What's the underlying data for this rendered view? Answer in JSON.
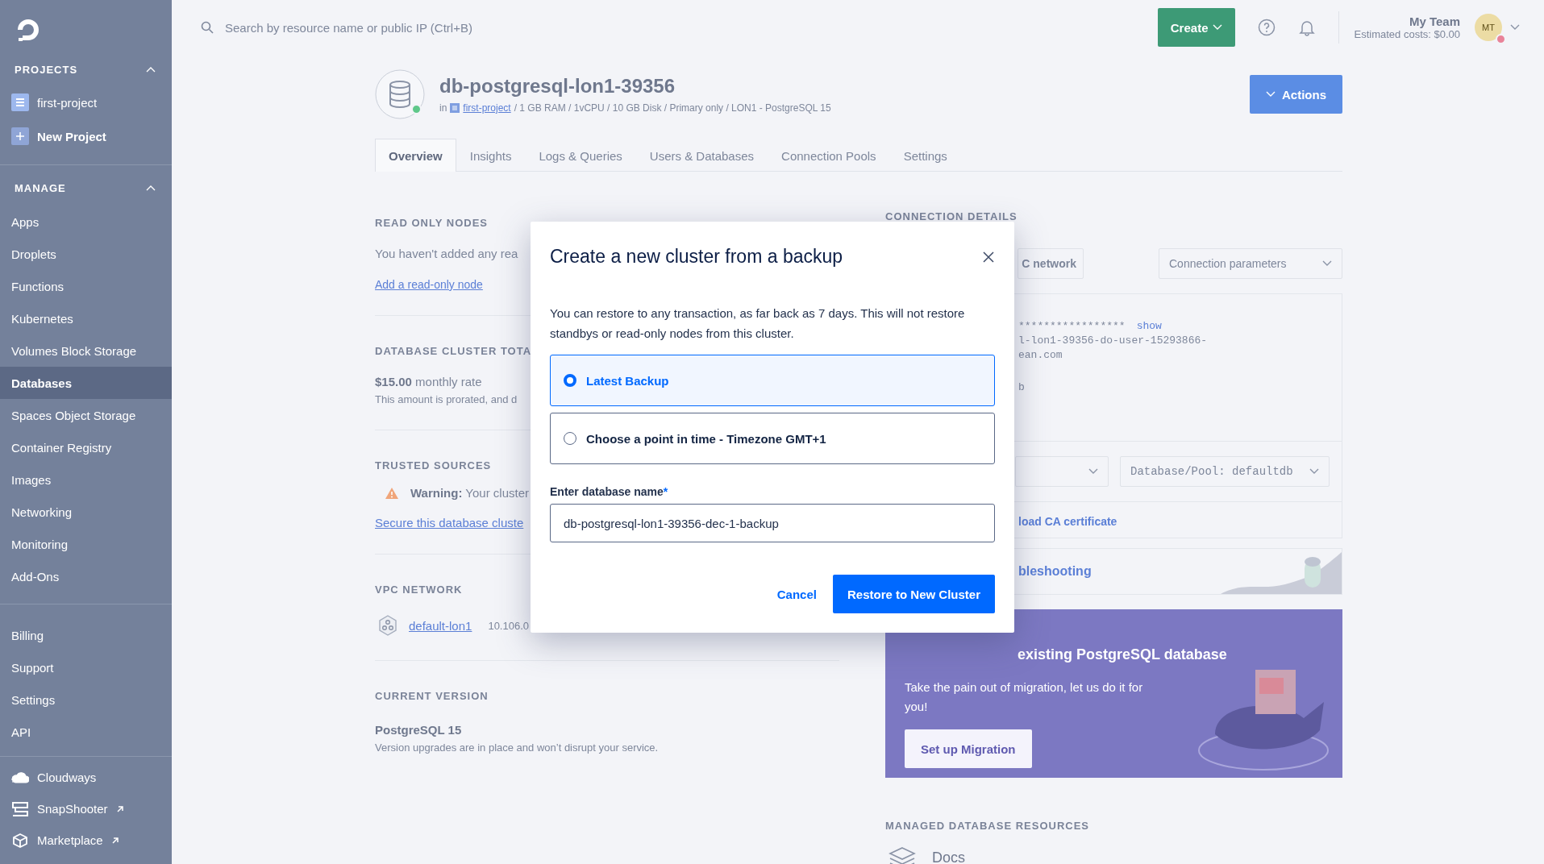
{
  "sidebar": {
    "projects": {
      "title": "PROJECTS",
      "expanded": true,
      "items": [
        {
          "label": "first-project",
          "kind": "project"
        },
        {
          "label": "New Project",
          "kind": "add"
        }
      ]
    },
    "manage": {
      "title": "MANAGE",
      "expanded": true,
      "items": [
        {
          "label": "Apps",
          "selected": false
        },
        {
          "label": "Droplets",
          "selected": false
        },
        {
          "label": "Functions",
          "selected": false
        },
        {
          "label": "Kubernetes",
          "selected": false
        },
        {
          "label": "Volumes Block Storage",
          "selected": false
        },
        {
          "label": "Databases",
          "selected": true
        },
        {
          "label": "Spaces Object Storage",
          "selected": false
        },
        {
          "label": "Container Registry",
          "selected": false
        },
        {
          "label": "Images",
          "selected": false
        },
        {
          "label": "Networking",
          "selected": false
        },
        {
          "label": "Monitoring",
          "selected": false
        },
        {
          "label": "Add-Ons",
          "selected": false
        }
      ]
    },
    "account": [
      {
        "label": "Billing",
        "selected": false
      },
      {
        "label": "Support",
        "selected": false
      },
      {
        "label": "Settings",
        "selected": false
      },
      {
        "label": "API",
        "selected": false
      }
    ],
    "apps": [
      {
        "label": "Cloudways",
        "kind": "cloud",
        "external": false
      },
      {
        "label": "SnapShooter",
        "kind": "snapshooter",
        "external": true
      },
      {
        "label": "Marketplace",
        "kind": "marketplace",
        "external": true
      }
    ]
  },
  "topbar": {
    "search": {
      "placeholder": "Search by resource name or public IP (Ctrl+B)"
    },
    "create_button": "Create",
    "team": {
      "name": "My Team",
      "costs": "Estimated costs: $0.00"
    },
    "avatar": {
      "initials": "MT"
    }
  },
  "header": {
    "title": "db-postgresql-lon1-39356",
    "online": true,
    "prefix": "in",
    "project_link": "first-project",
    "specs": "/ 1 GB RAM / 1vCPU / 10 GB Disk / Primary only / LON1 - PostgreSQL 15",
    "actions_button": "Actions"
  },
  "tabs": [
    {
      "label": "Overview",
      "selected": true
    },
    {
      "label": "Insights",
      "selected": false
    },
    {
      "label": "Logs & Queries",
      "selected": false
    },
    {
      "label": "Users & Databases",
      "selected": false
    },
    {
      "label": "Connection Pools",
      "selected": false
    },
    {
      "label": "Settings",
      "selected": false
    }
  ],
  "read_only_nodes": {
    "heading": "READ ONLY NODES",
    "text": "You haven't added any rea",
    "link": "Add a read-only node"
  },
  "cluster_total": {
    "heading": "DATABASE CLUSTER TOTA",
    "price": "**$15.00** monthly rate",
    "note": "This amount is prorated, and d"
  },
  "trusted_sources": {
    "heading": "TRUSTED SOURCES",
    "warning": "**Warning:** Your cluster",
    "link": "Secure this database cluste"
  },
  "vpc_network": {
    "heading": "VPC NETWORK",
    "name": "default-lon1",
    "ip": "10.106.0"
  },
  "current_version": {
    "heading": "CURRENT VERSION",
    "version": "PostgreSQL 15",
    "note": "Version upgrades are in place and won’t disrupt your service."
  },
  "connection_details": {
    "heading": "CONNECTION DETAILS",
    "network_toggle": "C network",
    "params_dropdown": "Connection parameters",
    "lines": [
      {
        "text": "*****************",
        "link": "show"
      },
      {
        "text": "l-lon1-39356-do-user-15293866-"
      },
      {
        "text": "ean.com"
      },
      {
        "text": "b"
      }
    ],
    "pool_dropdown": "Database/Pool: defaultdb",
    "ca_link": "load CA certificate"
  },
  "troubleshooting": {
    "text": "bleshooting"
  },
  "migration": {
    "heading": "existing PostgreSQL database",
    "text": "Take the pain out of migration, let us do it for you!",
    "button": "Set up Migration"
  },
  "resources": {
    "heading": "MANAGED DATABASE RESOURCES",
    "items": [
      {
        "label": "Docs"
      }
    ]
  },
  "modal": {
    "title": "Create a new cluster from a backup",
    "body": "You can restore to any transaction, as far back as 7 days. This will not restore standbys or read-only nodes from this cluster.",
    "options": [
      {
        "label": "Latest Backup",
        "selected": true
      },
      {
        "label": "Choose a point in time - Timezone GMT+1",
        "selected": false
      }
    ],
    "field": {
      "label": "Enter database name",
      "required_mark": "*",
      "value": "db-postgresql-lon1-39356-dec-1-backup"
    },
    "cancel_button": "Cancel",
    "confirm_button": "Restore to New Cluster"
  }
}
